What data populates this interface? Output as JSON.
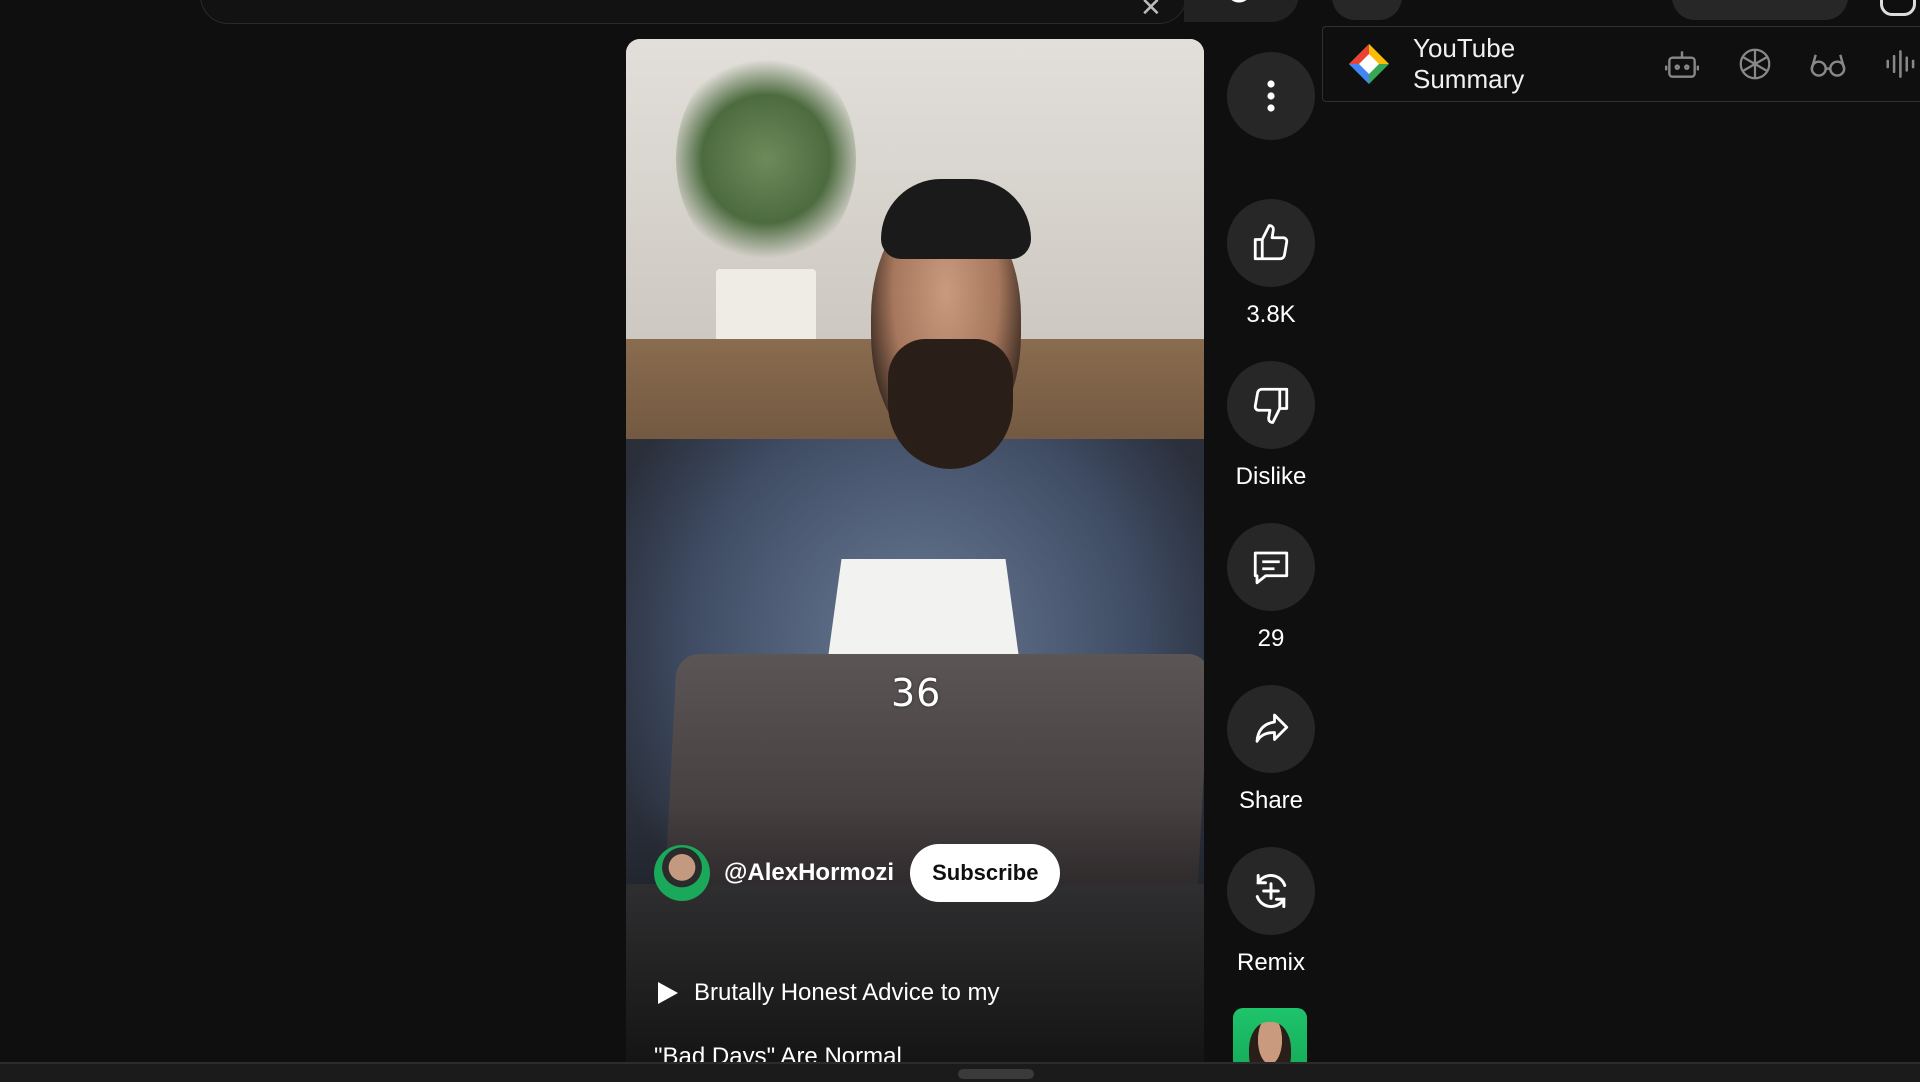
{
  "header": {
    "search_placeholder": "",
    "icons": [
      "clear-icon",
      "search-icon",
      "mic-icon",
      "create-icon",
      "notifications-icon"
    ]
  },
  "video": {
    "overlay_counter": "36",
    "channel": {
      "handle": "@AlexHormozi",
      "subscribe_label": "Subscribe"
    },
    "title": "Brutally Honest Advice to my",
    "description": "\"Bad Days\" Are Normal"
  },
  "actions": {
    "like": {
      "label": "3.8K",
      "icon": "thumbs-up-icon"
    },
    "dislike": {
      "label": "Dislike",
      "icon": "thumbs-down-icon"
    },
    "comments": {
      "label": "29",
      "icon": "comment-icon"
    },
    "share": {
      "label": "Share",
      "icon": "share-icon"
    },
    "remix": {
      "label": "Remix",
      "icon": "remix-icon"
    },
    "more": {
      "icon": "more-vertical-icon"
    }
  },
  "extension": {
    "title": "YouTube Summary",
    "tools": [
      "robot-icon",
      "openai-icon",
      "glasses-icon",
      "audio-wave-icon"
    ],
    "logo_colors": [
      "#ea4335",
      "#fbbc05",
      "#34a853",
      "#4285f4"
    ]
  },
  "theme": {
    "background": "#0f0f0f",
    "button_bg": "#272727",
    "text": "#ffffff"
  }
}
